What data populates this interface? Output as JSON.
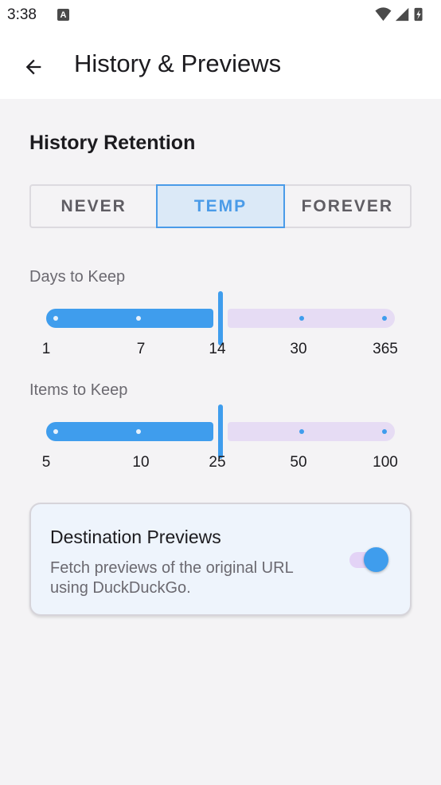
{
  "status_bar": {
    "time": "3:38",
    "notification_icon": "A"
  },
  "app_bar": {
    "title": "History & Previews",
    "back_icon": "arrow-left-icon"
  },
  "history_retention": {
    "title": "History Retention",
    "options": [
      "NEVER",
      "TEMP",
      "FOREVER"
    ],
    "selected": "TEMP"
  },
  "days_slider": {
    "label": "Days to Keep",
    "ticks": [
      "1",
      "7",
      "14",
      "30",
      "365"
    ],
    "value": "14"
  },
  "items_slider": {
    "label": "Items to Keep",
    "ticks": [
      "5",
      "10",
      "25",
      "50",
      "100"
    ],
    "value": "25"
  },
  "previews_card": {
    "title": "Destination Previews",
    "description": "Fetch previews of the original URL using DuckDuckGo.",
    "enabled": true
  },
  "colors": {
    "accent": "#3f9ded",
    "inactive_track": "#e6dcf4",
    "background": "#f4f3f5"
  }
}
